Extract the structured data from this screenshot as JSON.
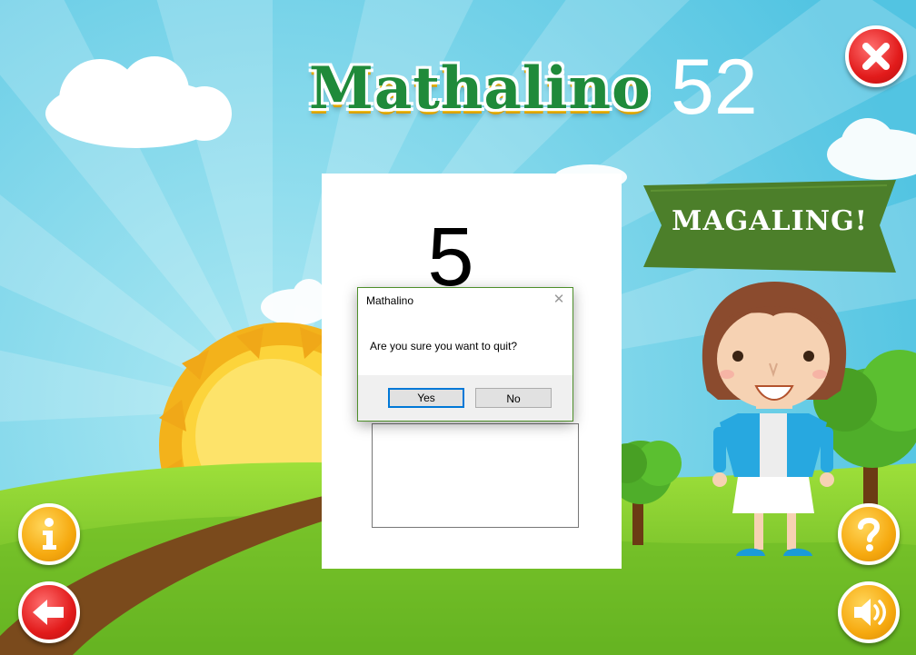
{
  "game": {
    "title": "Mathalino",
    "score": "52",
    "current_number": "5",
    "feedback_banner": "MAGALING!",
    "answer_value": ""
  },
  "dialog": {
    "title": "Mathalino",
    "message": "Are you sure you want to quit?",
    "yes_label": "Yes",
    "no_label": "No",
    "close_glyph": "✕"
  },
  "icons": {
    "close": "close-icon",
    "info": "info-icon",
    "back": "back-arrow-icon",
    "help": "help-icon",
    "sound": "sound-icon"
  },
  "colors": {
    "sky": "#5ecbe6",
    "grass": "#7cc82b",
    "banner": "#4c7f2a",
    "dialog_border": "#4e8f2a",
    "button_focus": "#0078d7",
    "title_green": "#1f8a3a"
  }
}
